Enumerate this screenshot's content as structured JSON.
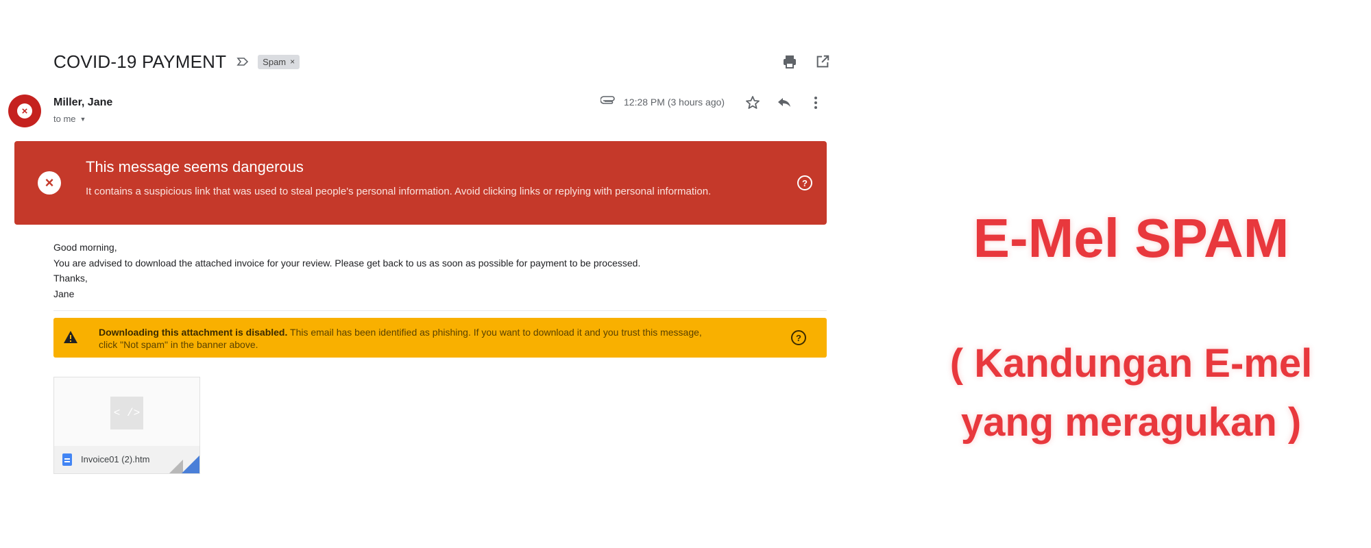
{
  "email": {
    "subject": "COVID-19 PAYMENT",
    "spam_label": "Spam",
    "spam_close": "×",
    "sender_name": "Miller, Jane",
    "recipient": "to me",
    "timestamp": "12:28 PM (3 hours ago)",
    "icons": {
      "label": "label-icon",
      "print": "print-icon",
      "open_new_window": "open-in-new-icon",
      "attachment": "paperclip-icon",
      "star": "star-icon",
      "reply": "reply-icon",
      "more": "more-vert-icon",
      "danger": "cancel-icon",
      "help": "help-icon",
      "warning": "warning-icon",
      "file": "document-icon"
    },
    "danger_banner": {
      "title": "This message seems dangerous",
      "body": "It contains a suspicious link that was used to steal people's personal information. Avoid clicking links or replying with personal information.",
      "help_glyph": "?"
    },
    "body_lines": [
      "Good morning,",
      "You are advised to download the attached invoice for your review. Please get back to us as soon as possible for payment to be processed.",
      "Thanks,",
      "Jane"
    ],
    "warning_banner": {
      "strong": "Downloading this attachment is disabled.",
      "text": " This email has been identified as phishing. If you want to download it and you trust this message, click \"Not spam\" in the banner above.",
      "help_glyph": "?"
    },
    "attachment": {
      "preview_glyph": "< />",
      "file_name": "Invoice01 (2).htm"
    }
  },
  "heading": {
    "title": "E-Mel SPAM",
    "subtitle_line1": "( Kandungan E-mel",
    "subtitle_line2": "yang meragukan )"
  },
  "colors": {
    "danger": "#c5392a",
    "warning": "#f9b000",
    "heading": "#e8383d",
    "avatar": "#c5221f"
  }
}
